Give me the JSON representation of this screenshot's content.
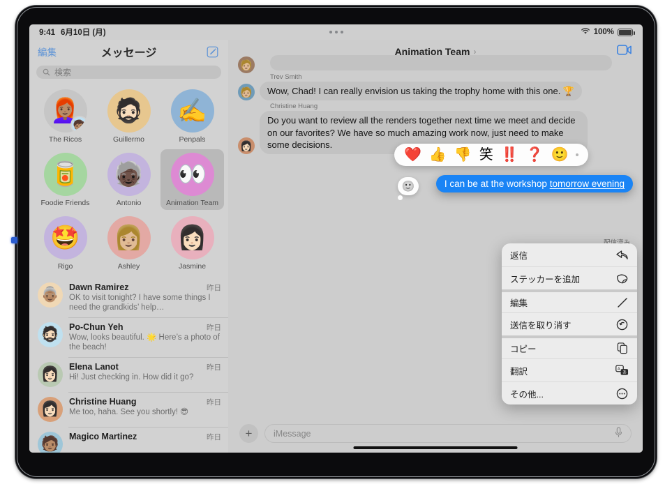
{
  "status_bar": {
    "time": "9:41",
    "date": "6月10日 (月)",
    "wifi_icon": "wifi-icon",
    "battery_percent": "100%",
    "battery_icon": "battery-full-icon",
    "multitask_icon": "multitask-dots-icon"
  },
  "sidebar": {
    "edit_label": "編集",
    "title": "メッセージ",
    "compose_icon": "compose-icon",
    "search": {
      "placeholder": "検索",
      "icon": "search-icon"
    },
    "pinned": [
      {
        "label": "The Ricos",
        "glyph": "👩🏽‍🦰",
        "sub_glyph": "🧒🏽",
        "bg": "#c6c6c6",
        "selected": false,
        "group": true
      },
      {
        "label": "Guillermo",
        "glyph": "🧔🏻",
        "bg": "#e7c78f",
        "selected": false
      },
      {
        "label": "Penpals",
        "glyph": "✍️",
        "bg": "#8fb4d6",
        "selected": false
      },
      {
        "label": "Foodie Friends",
        "glyph": "🥫",
        "bg": "#a5d6a0",
        "selected": false
      },
      {
        "label": "Antonio",
        "glyph": "🧓🏿",
        "bg": "#c3b4de",
        "selected": false
      },
      {
        "label": "Animation Team",
        "glyph": "👀",
        "bg": "#dd8ad3",
        "selected": true
      },
      {
        "label": "Rigo",
        "glyph": "🤩",
        "bg": "#c3b4de",
        "selected": false
      },
      {
        "label": "Ashley",
        "glyph": "👩🏼",
        "bg": "#e3a9a4",
        "selected": false
      },
      {
        "label": "Jasmine",
        "glyph": "👩🏻",
        "bg": "#e8b0bd",
        "selected": false
      }
    ],
    "conversations": [
      {
        "name": "Dawn Ramirez",
        "time": "昨日",
        "preview": "OK to visit tonight? I have some things I need the grandkids’ help…",
        "glyph": "👵🏽",
        "bg": "#f0d8b5"
      },
      {
        "name": "Po-Chun Yeh",
        "time": "昨日",
        "preview": "Wow, looks beautiful. 🌟 Here’s a photo of the beach!",
        "glyph": "🧔🏻",
        "bg": "#bfe0ef"
      },
      {
        "name": "Elena Lanot",
        "time": "昨日",
        "preview": "Hi! Just checking in. How did it go?",
        "glyph": "👩🏻",
        "bg": "#b9c9b2"
      },
      {
        "name": "Christine Huang",
        "time": "昨日",
        "preview": "Me too, haha. See you shortly! 😎",
        "glyph": "👩🏻",
        "bg": "#d8a079"
      },
      {
        "name": "Magico Martinez",
        "time": "昨日",
        "preview": "",
        "glyph": "🧑🏽",
        "bg": "#9ec6d8"
      }
    ]
  },
  "chat": {
    "title": "Animation Team",
    "chevron_icon": "chevron-right-icon",
    "facetime_icon": "facetime-video-icon",
    "messages": [
      {
        "sender": "Trev Smith",
        "text": "Wow, Chad! I can really envision us taking the trophy home with this one. 🏆",
        "side": "them",
        "glyph": "🧑🏼",
        "bg": "#6f9bb8"
      },
      {
        "sender": "Christine Huang",
        "text": "Do you want to review all the renders together next time we meet and decide on our favorites? We have so much amazing work now, just need to make some decisions.",
        "side": "them",
        "glyph": "👩🏻",
        "bg": "#c98e6c"
      }
    ],
    "highlighted_message": {
      "text_before": "I can be at the workshop ",
      "text_underlined": "tomorrow evening",
      "full_text": "I can be at the workshop tomorrow evening",
      "delivered_label": "配信済み",
      "bubble_color": "#1a84f5"
    },
    "sticker_button_icon": "emoji-smiley-bubble-icon",
    "tapback": {
      "options": [
        "❤️",
        "👍",
        "👎",
        "笑",
        "‼️",
        "❓",
        "🙂"
      ],
      "more_icon": "more-dot-icon"
    },
    "context_menu": [
      {
        "label": "返信",
        "icon": "reply-arrow-icon",
        "group_start": false
      },
      {
        "label": "ステッカーを追加",
        "icon": "sticker-add-icon",
        "group_start": false
      },
      {
        "label": "編集",
        "icon": "pencil-edit-icon",
        "group_start": true
      },
      {
        "label": "送信を取り消す",
        "icon": "undo-send-icon",
        "group_start": false
      },
      {
        "label": "コピー",
        "icon": "copy-icon",
        "group_start": true
      },
      {
        "label": "翻訳",
        "icon": "translate-icon",
        "group_start": false
      },
      {
        "label": "その他...",
        "icon": "ellipsis-circle-icon",
        "group_start": false
      }
    ],
    "input": {
      "plus_label": "+",
      "placeholder": "iMessage",
      "mic_icon": "microphone-icon"
    }
  }
}
